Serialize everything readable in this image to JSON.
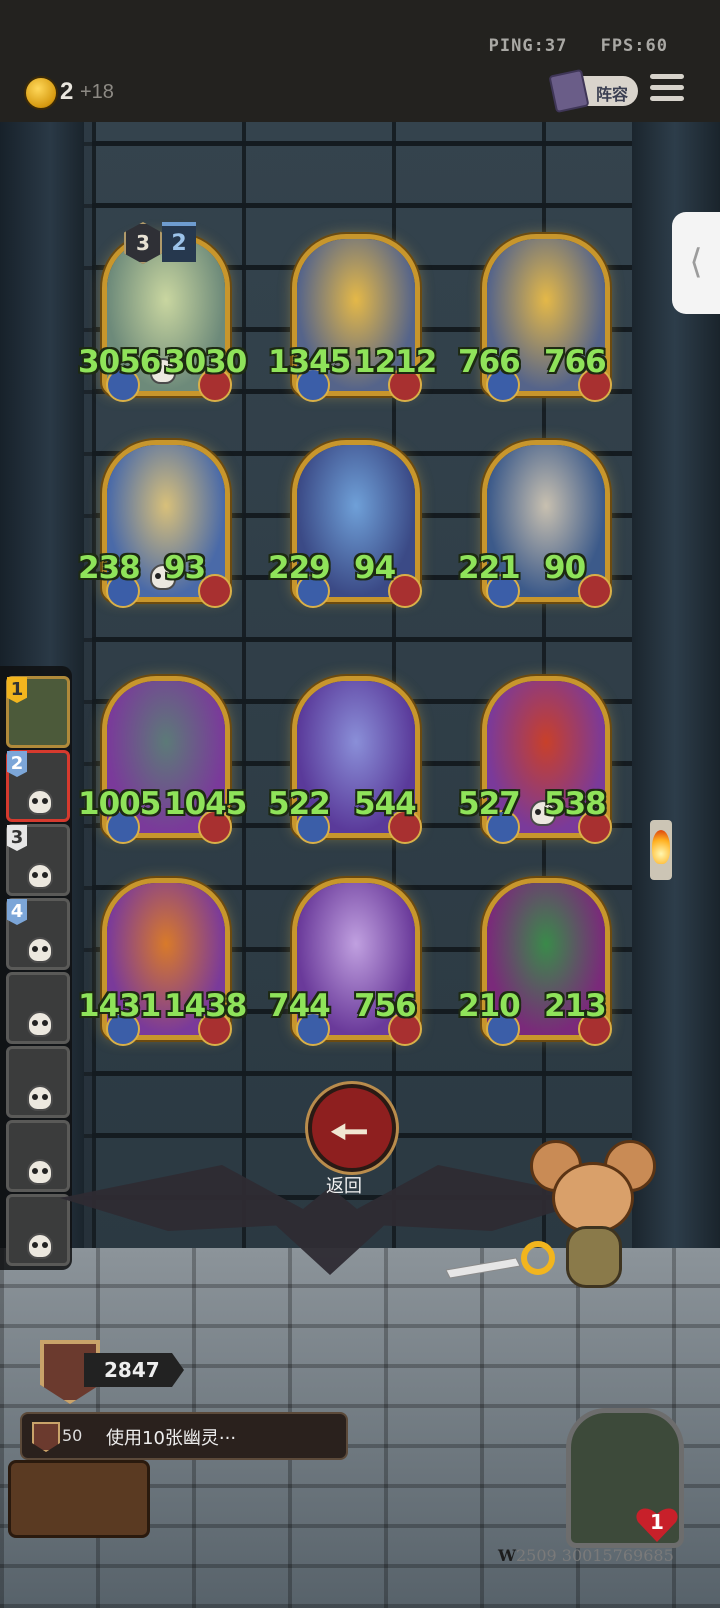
{
  "net": {
    "ping": "PING:37",
    "fps": "FPS:60"
  },
  "currency": {
    "count": "2",
    "increment": "+18"
  },
  "lineup_label": "阵容",
  "back_label": "返回",
  "card_badge": {
    "level": "3",
    "stars": "2"
  },
  "board": [
    {
      "name": "horse-spirit",
      "atk": "3056",
      "hp": "3030",
      "skull": true,
      "colors": [
        "#6d8a7a",
        "#c9d6a0"
      ]
    },
    {
      "name": "star-boy",
      "atk": "1345",
      "hp": "1212",
      "skull": false,
      "colors": [
        "#55648a",
        "#e4b848"
      ]
    },
    {
      "name": "star-boy-2",
      "atk": "766",
      "hp": "766",
      "skull": false,
      "colors": [
        "#55648a",
        "#e4b848"
      ]
    },
    {
      "name": "blue-archer",
      "atk": "238",
      "hp": "93",
      "skull": true,
      "colors": [
        "#4a6aa8",
        "#d8c07a"
      ]
    },
    {
      "name": "blue-sorceress",
      "atk": "229",
      "hp": "94",
      "skull": false,
      "colors": [
        "#3b4a86",
        "#6fa0d8"
      ]
    },
    {
      "name": "bearded-king",
      "atk": "221",
      "hp": "90",
      "skull": false,
      "colors": [
        "#3c5a8a",
        "#c8c0b0"
      ]
    },
    {
      "name": "fish-monster",
      "atk": "1005",
      "hp": "1045",
      "skull": false,
      "colors": [
        "#7a3a9a",
        "#5c7a78"
      ]
    },
    {
      "name": "old-wizard",
      "atk": "522",
      "hp": "544",
      "skull": false,
      "colors": [
        "#5a3a9a",
        "#8a8fd8"
      ]
    },
    {
      "name": "lobster-knight",
      "atk": "527",
      "hp": "538",
      "skull": true,
      "colors": [
        "#7a3a9a",
        "#c8402a"
      ]
    },
    {
      "name": "pumpkin-ghost",
      "atk": "1431",
      "hp": "1438",
      "skull": false,
      "colors": [
        "#7a3a9a",
        "#d87a2a"
      ]
    },
    {
      "name": "purple-queen",
      "atk": "744",
      "hp": "756",
      "skull": false,
      "colors": [
        "#6a3a9a",
        "#c0a0e0"
      ]
    },
    {
      "name": "green-dragon",
      "atk": "210",
      "hp": "213",
      "skull": false,
      "colors": [
        "#7a2a7a",
        "#3a8a4a"
      ]
    }
  ],
  "hand": [
    {
      "num": "1",
      "style": "gold"
    },
    {
      "num": "2",
      "style": "blue"
    },
    {
      "num": "3",
      "style": "white"
    },
    {
      "num": "4",
      "style": "blue"
    },
    {
      "num": "",
      "style": ""
    },
    {
      "num": "",
      "style": ""
    },
    {
      "num": "",
      "style": ""
    },
    {
      "num": "",
      "style": ""
    }
  ],
  "trophy": "2847",
  "quest": {
    "reward": "50",
    "text": "使用10张幽灵···"
  },
  "health": "1",
  "watermark": {
    "prefix": "W",
    "text": "2509 30015769685"
  }
}
